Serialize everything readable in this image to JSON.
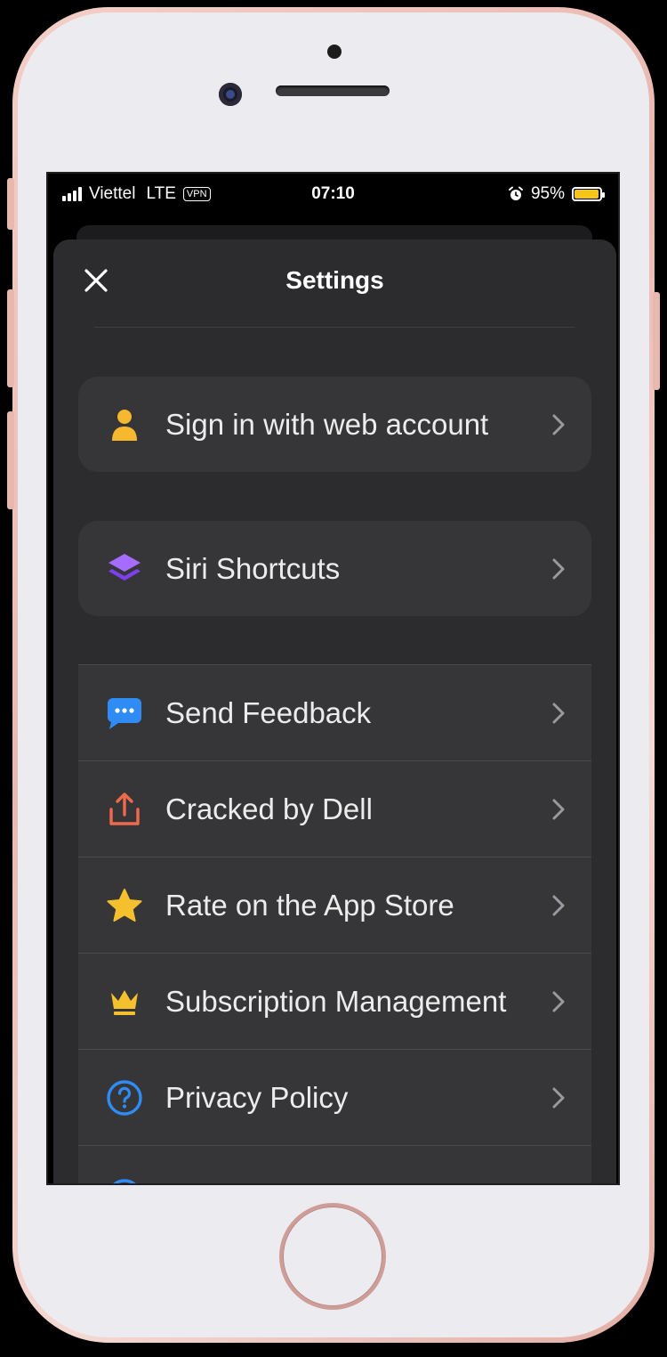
{
  "status_bar": {
    "carrier": "Viettel",
    "network": "LTE",
    "vpn": "VPN",
    "time": "07:10",
    "battery_percent": "95%",
    "battery_level": 0.95
  },
  "header": {
    "title": "Settings"
  },
  "colors": {
    "sheet_bg": "#2c2c2e",
    "row_bg": "#363638",
    "account_icon": "#f5b82e",
    "shortcuts_icon": "#9b59f6",
    "feedback_icon": "#2f8cf5",
    "share_icon": "#ef6a4a",
    "star_icon": "#f5c02e",
    "crown_icon": "#f5c02e",
    "privacy_icon": "#2f8cf5"
  },
  "account_group": {
    "items": [
      {
        "label": "Sign in with web account",
        "icon": "person-icon"
      }
    ]
  },
  "shortcuts_group": {
    "items": [
      {
        "label": "Siri Shortcuts",
        "icon": "layers-icon"
      }
    ]
  },
  "main_list": {
    "items": [
      {
        "label": "Send Feedback",
        "icon": "chat-bubble-icon"
      },
      {
        "label": "Cracked by Dell",
        "icon": "share-icon"
      },
      {
        "label": "Rate on the App Store",
        "icon": "star-icon"
      },
      {
        "label": "Subscription Management",
        "icon": "crown-icon"
      },
      {
        "label": "Privacy Policy",
        "icon": "question-circle-icon"
      }
    ]
  }
}
